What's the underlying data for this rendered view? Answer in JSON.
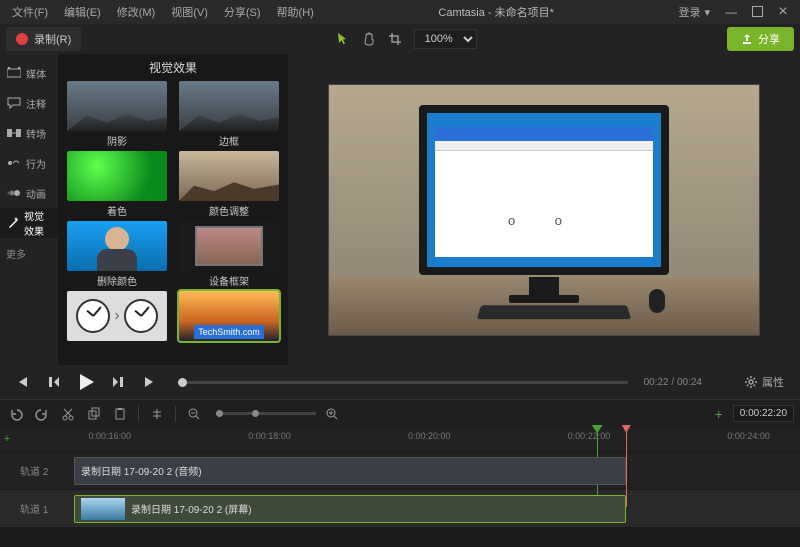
{
  "app_title": "Camtasia - 未命名项目*",
  "menu": [
    "文件(F)",
    "编辑(E)",
    "修改(M)",
    "视图(V)",
    "分享(S)",
    "帮助(H)"
  ],
  "account": {
    "label": "登录",
    "chevron": "▾"
  },
  "toolbar": {
    "record": "录制(R)",
    "zoom": "100%",
    "share": "分享"
  },
  "rail": {
    "items": [
      "媒体",
      "注释",
      "转场",
      "行为",
      "动画",
      "视觉效果"
    ],
    "more": "更多"
  },
  "effects": {
    "title": "视觉效果",
    "items": [
      {
        "label": "阴影"
      },
      {
        "label": "边框"
      },
      {
        "label": "着色"
      },
      {
        "label": "颜色调整"
      },
      {
        "label": "删除颜色"
      },
      {
        "label": "设备框架"
      },
      {
        "label": ""
      },
      {
        "label": ""
      }
    ],
    "banner": "TechSmith.com"
  },
  "preview": {
    "loading": "o   o"
  },
  "playback": {
    "current": "00:22",
    "total": "00:24",
    "properties": "属性"
  },
  "timeline": {
    "duration": "0:00:22:20",
    "ticks": [
      "0:00:16:00",
      "0:00:18:00",
      "0:00:20:00",
      "0:00:22:00",
      "0:00:24:00"
    ],
    "tracks": [
      {
        "name": "轨道 2",
        "clip": "录制日期 17-09-20 2 (音频)",
        "thumb": false,
        "sel": false
      },
      {
        "name": "轨道 1",
        "clip": "录制日期 17-09-20 2 (屏幕)",
        "thumb": true,
        "sel": true
      }
    ]
  }
}
